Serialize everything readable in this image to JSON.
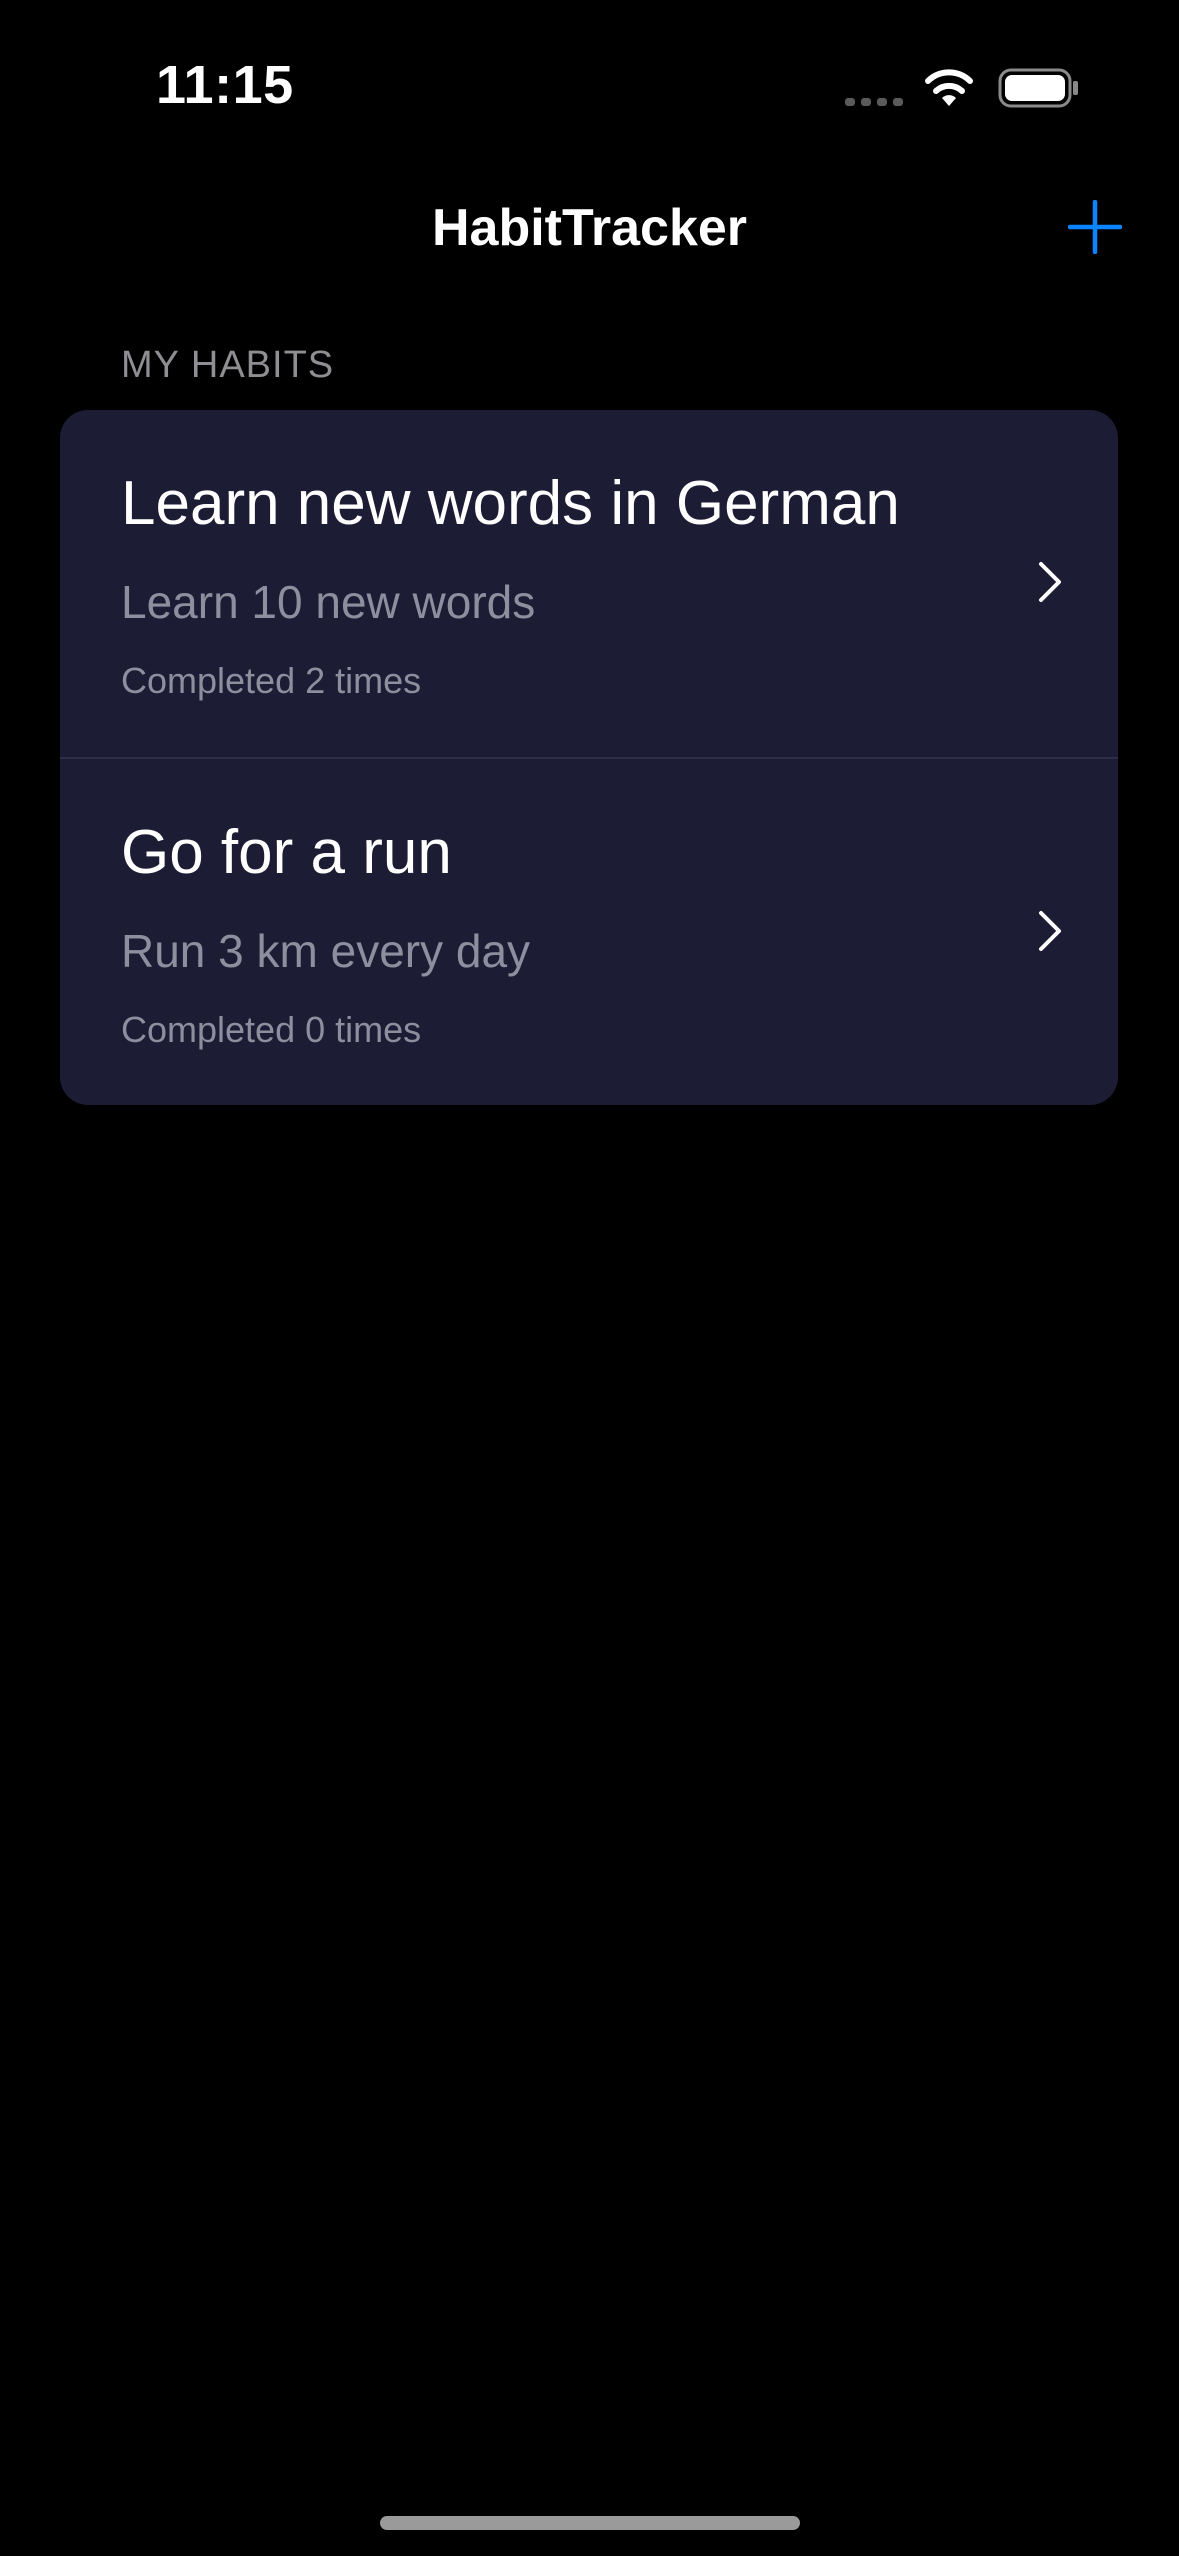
{
  "status_bar": {
    "time": "11:15",
    "icons": [
      "signal-icon",
      "wifi-icon",
      "battery-icon"
    ]
  },
  "nav": {
    "title": "HabitTracker",
    "add_icon": "plus-icon",
    "accent_color": "#0a84ff"
  },
  "section": {
    "header": "MY HABITS"
  },
  "habits": [
    {
      "title": "Learn new words in German",
      "description": "Learn 10 new words",
      "completed": "Completed 2 times"
    },
    {
      "title": "Go for a run",
      "description": "Run 3 km every day",
      "completed": "Completed 0 times"
    }
  ],
  "colors": {
    "background": "#000000",
    "card": "#1c1c35",
    "secondary_text": "#8e8e9e"
  }
}
